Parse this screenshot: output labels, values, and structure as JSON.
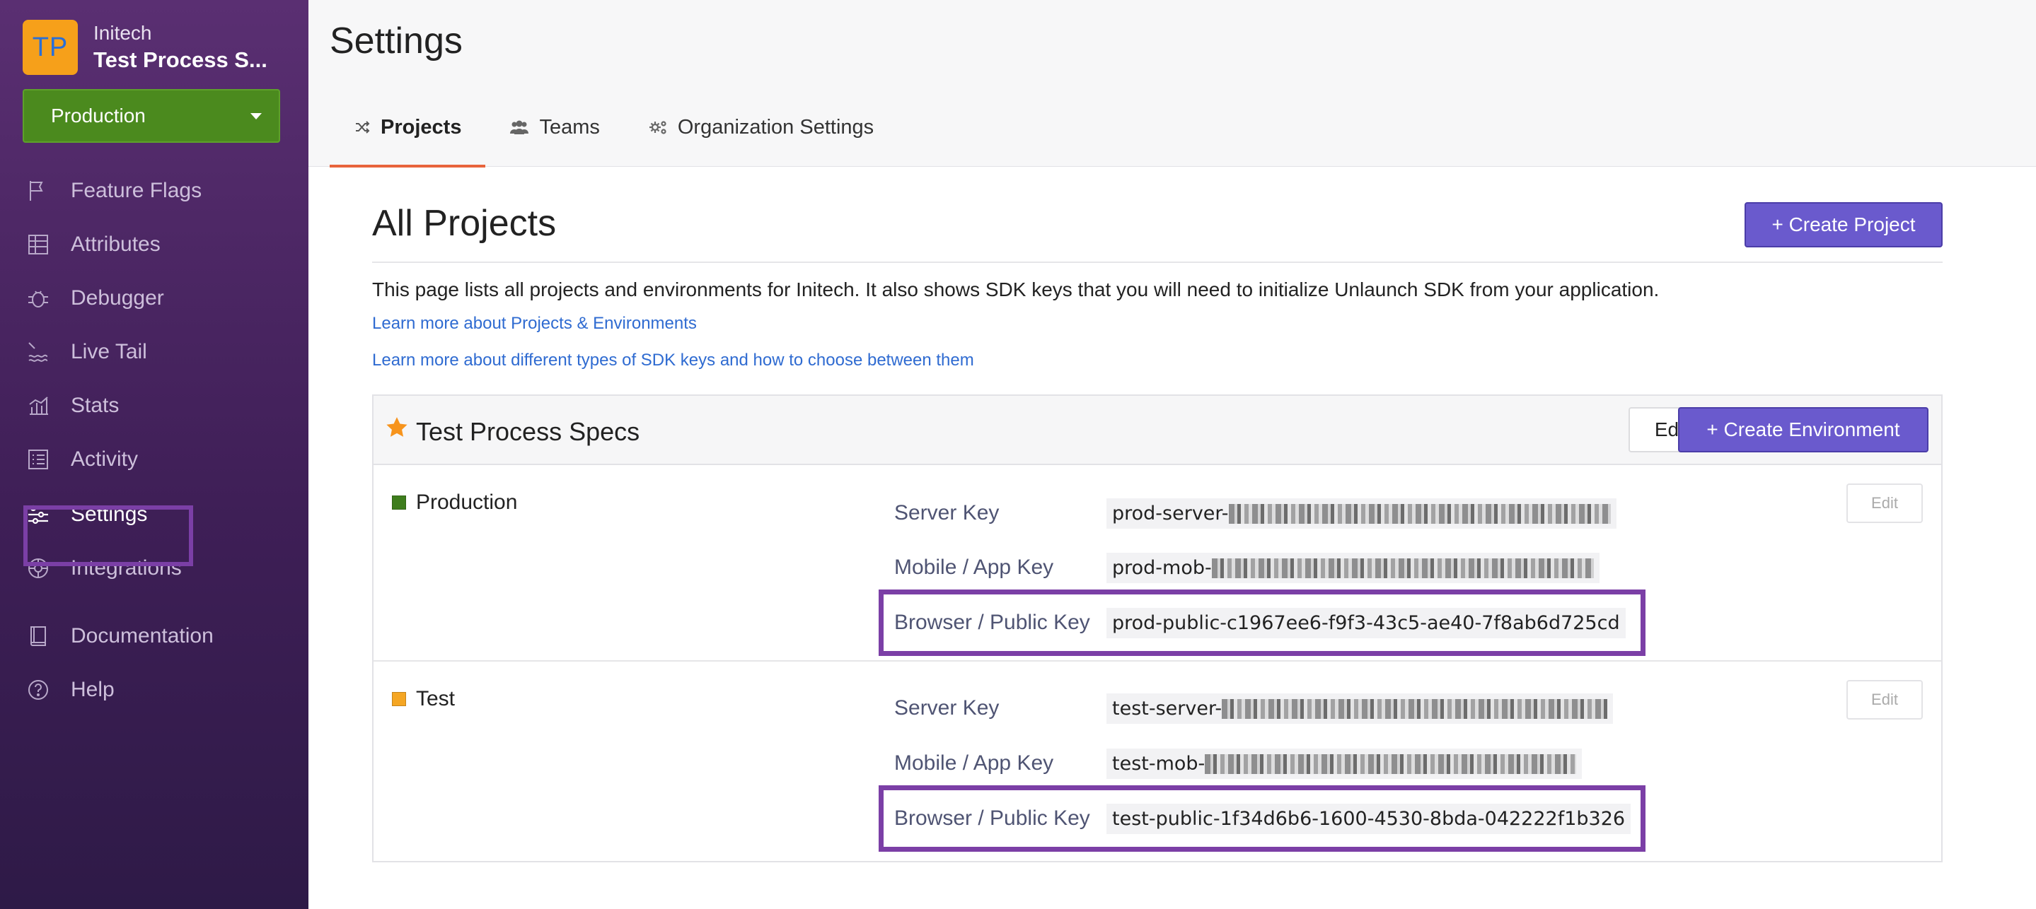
{
  "brand": {
    "logo_text": "TP",
    "org": "Initech",
    "project": "Test Process S..."
  },
  "env_selector": {
    "value": "Production"
  },
  "nav": [
    {
      "label": "Feature Flags",
      "icon": "flag-icon"
    },
    {
      "label": "Attributes",
      "icon": "attributes-icon"
    },
    {
      "label": "Debugger",
      "icon": "bug-icon"
    },
    {
      "label": "Live Tail",
      "icon": "live-tail-icon"
    },
    {
      "label": "Stats",
      "icon": "stats-icon"
    },
    {
      "label": "Activity",
      "icon": "activity-icon"
    },
    {
      "label": "Settings",
      "icon": "sliders-icon"
    },
    {
      "label": "Integrations",
      "icon": "integrations-icon"
    },
    {
      "label": "Documentation",
      "icon": "book-icon"
    },
    {
      "label": "Help",
      "icon": "help-icon"
    }
  ],
  "page": {
    "title": "Settings"
  },
  "tabs": [
    {
      "label": "Projects",
      "icon": "shuffle-icon"
    },
    {
      "label": "Teams",
      "icon": "team-icon"
    },
    {
      "label": "Organization Settings",
      "icon": "cogs-icon"
    }
  ],
  "projects": {
    "title": "All Projects",
    "create_label": "+ Create Project",
    "description": "This page lists all projects and environments for Initech. It also shows SDK keys that you will need to initialize Unlaunch SDK from your application.",
    "link1": "Learn more about Projects & Environments",
    "link2": "Learn more about different types of SDK keys and how to choose between them"
  },
  "project": {
    "name": "Test Process Specs",
    "edit_label": "Edit",
    "create_env_label": "+ Create Environment",
    "environments": [
      {
        "name": "Production",
        "color": "#3e7d1d",
        "edit_label": "Edit",
        "server_label": "Server Key",
        "server_prefix": "prod-server-",
        "mobile_label": "Mobile / App Key",
        "mobile_prefix": "prod-mob-",
        "browser_label": "Browser / Public Key",
        "browser_key": "prod-public-c1967ee6-f9f3-43c5-ae40-7f8ab6d725cd"
      },
      {
        "name": "Test",
        "color": "#f5a623",
        "edit_label": "Edit",
        "server_label": "Server Key",
        "server_prefix": "test-server-",
        "mobile_label": "Mobile / App Key",
        "mobile_prefix": "test-mob-",
        "browser_label": "Browser / Public Key",
        "browser_key": "test-public-1f34d6b6-1600-4530-8bda-042222f1b326"
      }
    ]
  }
}
